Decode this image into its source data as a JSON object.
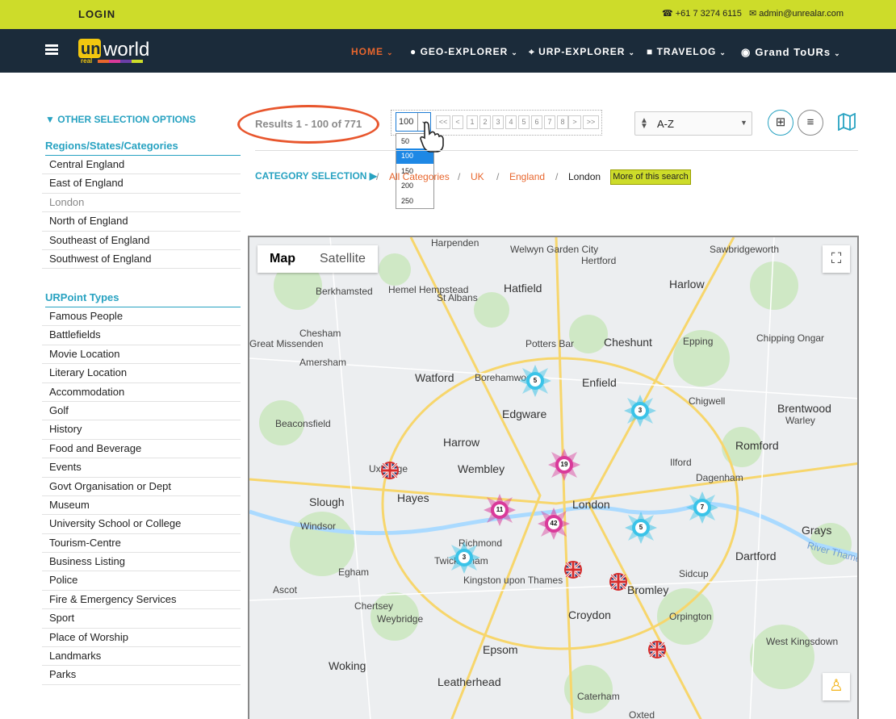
{
  "topbar": {
    "login": "LOGIN",
    "phone": "☎ +61 7 3274 6115",
    "email": "✉ admin@unrealar.com"
  },
  "nav": {
    "logo_text_1": "un",
    "logo_text_2": "world",
    "logo_text_3": "real",
    "items": [
      {
        "label": "HOME",
        "active": true
      },
      {
        "label": "● GEO-EXPLORER",
        "active": false
      },
      {
        "label": "⌖ URP-EXPLORER",
        "active": false
      },
      {
        "label": "■ TRAVELOG",
        "active": false
      },
      {
        "label": "Grand ToURs",
        "active": false
      }
    ]
  },
  "sidebar": {
    "other_options": "▼ OTHER SELECTION OPTIONS",
    "regions_title": "Regions/States/Categories",
    "regions": [
      "Central England",
      "East of England",
      "London",
      "North of England",
      "Southeast of England",
      "Southwest of England"
    ],
    "urpoint_title": "URPoint Types",
    "urpoint_types": [
      "Famous People",
      "Battlefields",
      "Movie Location",
      "Literary Location",
      "Accommodation",
      "Golf",
      "History",
      "Food and Beverage",
      "Events",
      "Govt Organisation or Dept",
      "Museum",
      "University School or College",
      "Tourism-Centre",
      "Business Listing",
      "Police",
      "Fire & Emergency Services",
      "Sport",
      "Place of Worship",
      "Landmarks",
      "Parks"
    ]
  },
  "results": {
    "text": "Results 1 - 100 of 771",
    "per_page": "100",
    "per_page_options": [
      "50",
      "100",
      "150",
      "200",
      "250"
    ],
    "pager": [
      "<<",
      "<",
      "1",
      "2",
      "3",
      "4",
      "5",
      "6",
      "7",
      "8",
      ">",
      ">>"
    ]
  },
  "sort": {
    "label": "A-Z"
  },
  "breadcrumb": {
    "label": "CATEGORY SELECTION ▶",
    "items": [
      "All Categories",
      "UK",
      "England",
      "London"
    ],
    "more": "More of this search"
  },
  "map": {
    "toggle": [
      "Map",
      "Satellite"
    ],
    "places": [
      "Harpenden",
      "Welwyn Garden City",
      "Hertford",
      "Sawbridgeworth",
      "Berkhamsted",
      "Hemel Hempstead",
      "St Albans",
      "Hatfield",
      "Harlow",
      "Chesham",
      "Great Missenden",
      "Amersham",
      "Potters Bar",
      "Cheshunt",
      "Epping",
      "Chipping Ongar",
      "Watford",
      "Borehamwood",
      "Enfield",
      "Chigwell",
      "Brentwood",
      "Warley",
      "Beaconsfield",
      "Edgware",
      "Harrow",
      "Wembley",
      "Romford",
      "Ilford",
      "Dagenham",
      "Uxbridge",
      "Hayes",
      "Slough",
      "London",
      "Windsor",
      "Grays",
      "Richmond",
      "Twickenham",
      "Kingston upon Thames",
      "Dartford",
      "Sidcup",
      "Bromley",
      "Egham",
      "Ascot",
      "Chertsey",
      "Weybridge",
      "Croydon",
      "Orpington",
      "West Kingsdown",
      "Epsom",
      "Woking",
      "Leatherhead",
      "Caterham",
      "Oxted",
      "River Thames"
    ],
    "clusters": [
      {
        "count": "5",
        "color": "#3ac3e8"
      },
      {
        "count": "3",
        "color": "#3ac3e8"
      },
      {
        "count": "19",
        "color": "#d93a9a"
      },
      {
        "count": "11",
        "color": "#d93a9a"
      },
      {
        "count": "42",
        "color": "#d93a9a"
      },
      {
        "count": "7",
        "color": "#3ac3e8"
      },
      {
        "count": "5",
        "color": "#3ac3e8"
      },
      {
        "count": "3",
        "color": "#3ac3e8"
      }
    ]
  }
}
